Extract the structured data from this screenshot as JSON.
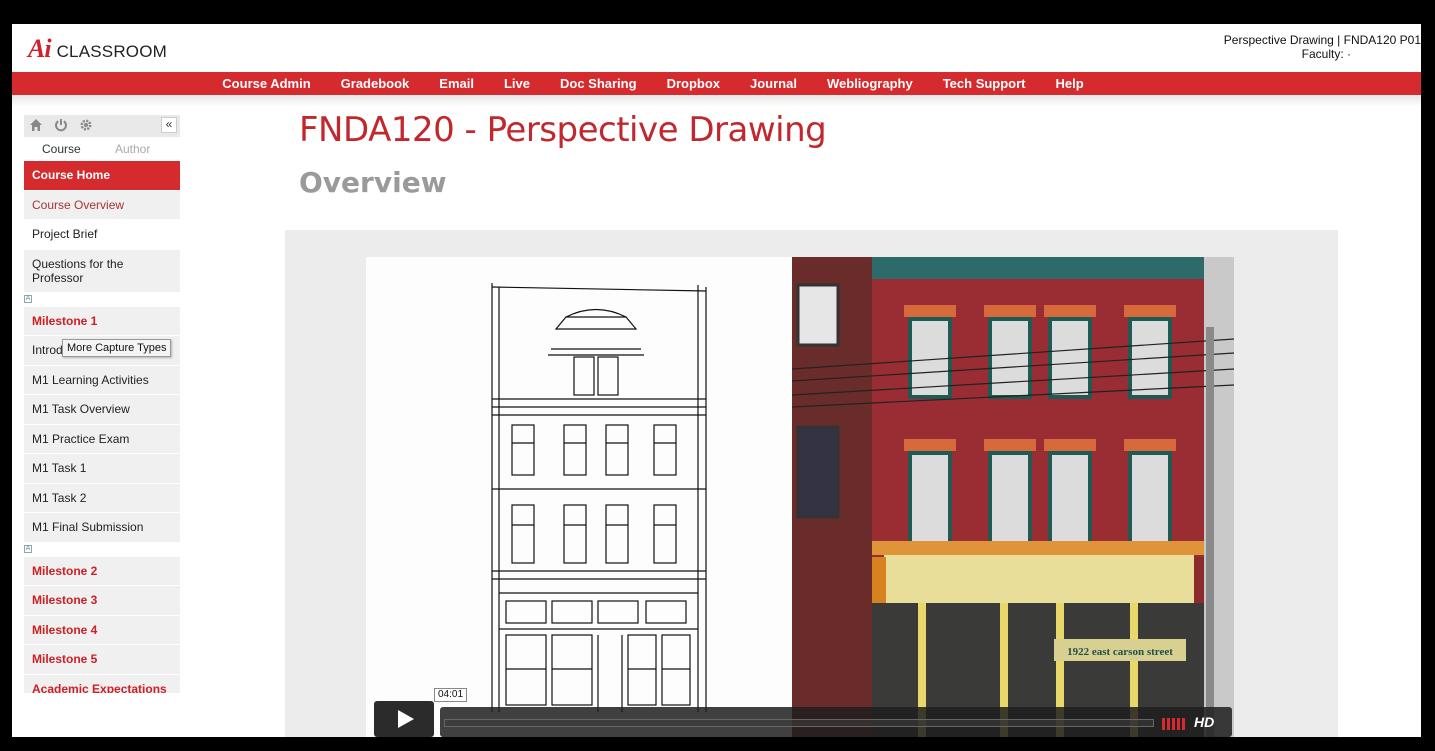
{
  "header": {
    "logo_mark": "Ai",
    "logo_text": "CLASSROOM",
    "course_title": "Perspective Drawing | FNDA120 P01",
    "faculty_label": "Faculty:",
    "faculty_value": "·"
  },
  "nav": {
    "items": [
      "Course Admin",
      "Gradebook",
      "Email",
      "Live",
      "Doc Sharing",
      "Dropbox",
      "Journal",
      "Webliography",
      "Tech Support",
      "Help"
    ]
  },
  "sidebar": {
    "icons": [
      "home-icon",
      "power-icon",
      "gear-icon"
    ],
    "collapse_label": "«",
    "mode_course": "Course",
    "mode_author": "Author",
    "items": [
      "Course Home",
      "Course Overview",
      "Project Brief",
      "Questions for the Professor",
      "Milestone 1",
      "Introd",
      "M1 Learning Activities",
      "M1 Task Overview",
      "M1 Practice Exam",
      "M1 Task 1",
      "M1 Task 2",
      "M1 Final Submission",
      "Milestone 2",
      "Milestone 3",
      "Milestone 4",
      "Milestone 5",
      "Academic Expectations"
    ],
    "toggle_symbol": "A",
    "tooltip": "More Capture Types"
  },
  "main": {
    "title": "FNDA120 - Perspective Drawing",
    "section": "Overview"
  },
  "video": {
    "time": "04:01",
    "hd_label": "HD",
    "storefront_text": "1922 east carson street",
    "colors": {
      "accent": "#d52a2e",
      "photo_brick": "#8c2a2e"
    }
  }
}
